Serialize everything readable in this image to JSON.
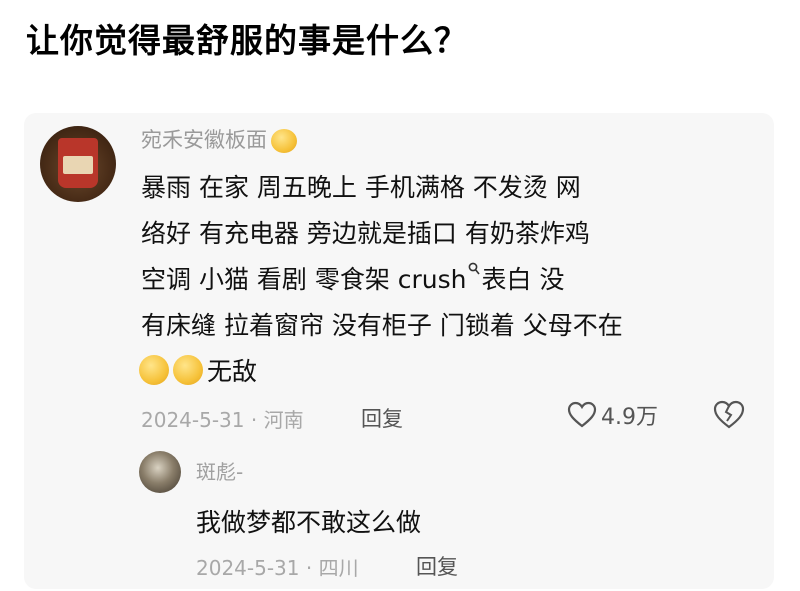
{
  "headline": "让你觉得最舒服的事是什么？",
  "comment": {
    "username": "宛禾安徽板面",
    "username_emoji_icon": "hot-face-emoji",
    "lines": [
      "暴雨  在家  周五晚上  手机满格  不发烫  网",
      "络好   有充电器  旁边就是插口   有奶茶炸鸡",
      "空调  小猫  看剧    零食架  crush",
      "有床缝  拉着窗帘  没有柜子  门锁着  父母不在"
    ],
    "line3_tail": "表白  没",
    "search_icon": "search-icon",
    "emoji_line": {
      "emojis": [
        "laughing-tears-emoji",
        "smirk-emoji"
      ],
      "text": "无敌"
    },
    "timestamp": "2024-5-31 · 河南",
    "reply_label": "回复",
    "likes": "4.9万",
    "like_icon": "heart-icon",
    "dislike_icon": "broken-heart-icon"
  },
  "reply": {
    "username": "斑彪-",
    "text": "我做梦都不敢这么做",
    "timestamp": "2024-5-31 · 四川",
    "reply_label": "回复"
  }
}
